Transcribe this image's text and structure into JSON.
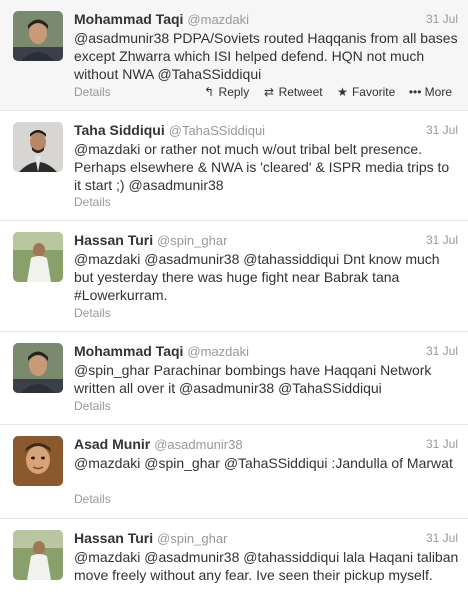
{
  "tweets": [
    {
      "fullname": "Mohammad Taqi",
      "screenname": "@mazdaki",
      "date": "31 Jul",
      "text": "@asadmunir38 PDPA/Soviets routed Haqqanis from all bases except Zhwarra which ISI helped defend. HQN not much without NWA @TahaSSiddiqui",
      "details": "Details",
      "actions": {
        "reply": "Reply",
        "retweet": "Retweet",
        "favorite": "Favorite",
        "more": "More"
      }
    },
    {
      "fullname": "Taha Siddiqui",
      "screenname": "@TahaSSiddiqui",
      "date": "31 Jul",
      "text": "@mazdaki or rather not much w/out tribal belt presence. Perhaps elsewhere & NWA is 'cleared' & ISPR media trips to it start ;) @asadmunir38",
      "details": "Details"
    },
    {
      "fullname": "Hassan Turi",
      "screenname": "@spin_ghar",
      "date": "31 Jul",
      "text": "@mazdaki @asadmunir38 @tahassiddiqui Dnt know much but yesterday there was huge fight near Babrak tana #Lowerkurram.",
      "details": "Details"
    },
    {
      "fullname": "Mohammad Taqi",
      "screenname": "@mazdaki",
      "date": "31 Jul",
      "text": "@spin_ghar Parachinar bombings have Haqqani Network written all over it @asadmunir38 @TahaSSiddiqui",
      "details": "Details"
    },
    {
      "fullname": "Asad Munir",
      "screenname": "@asadmunir38",
      "date": "31 Jul",
      "text": "@mazdaki @spin_ghar @TahaSSiddiqui :Jandulla of Marwat",
      "details": "Details"
    },
    {
      "fullname": "Hassan Turi",
      "screenname": "@spin_ghar",
      "date": "31 Jul",
      "text": "@mazdaki @asadmunir38 @tahassiddiqui lala Haqani taliban move freely without any fear. Ive seen their pickup myself."
    }
  ],
  "icons": {
    "reply": "reply-arrow-icon",
    "retweet": "retweet-icon",
    "favorite": "star-icon",
    "more": "more-dots-icon"
  }
}
